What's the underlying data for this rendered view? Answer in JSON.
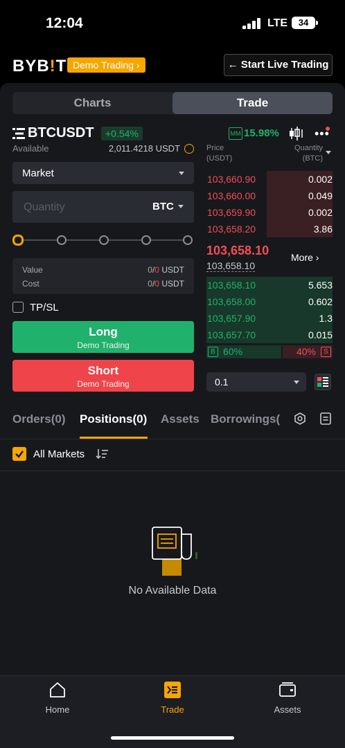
{
  "status_bar": {
    "time": "12:04",
    "network": "LTE",
    "battery": "34"
  },
  "header": {
    "logo_left": "BYB",
    "logo_bar": "!",
    "logo_right": "T",
    "demo_tag": "Demo Trading",
    "live_button": "Start Live Trading"
  },
  "view_tabs": {
    "charts": "Charts",
    "trade": "Trade",
    "selected": "Trade"
  },
  "pair": {
    "symbol": "BTCUSDT",
    "change": "+0.54%",
    "mm_label": "MM",
    "mm_value": "15.98%"
  },
  "order_form": {
    "available_label": "Available",
    "available_value": "2,011.4218 USDT",
    "order_type": "Market",
    "quantity_placeholder": "Quantity",
    "quantity_unit": "BTC",
    "leverage_fraction": 0,
    "value_label": "Value",
    "value_amount": "0/0 USDT",
    "value_a": "0",
    "value_b": "0",
    "value_unit": "USDT",
    "cost_label": "Cost",
    "cost_a": "0",
    "cost_b": "0",
    "cost_unit": "USDT",
    "tpsl_label": "TP/SL",
    "long_label": "Long",
    "long_sub": "Demo Trading",
    "short_label": "Short",
    "short_sub": "Demo Trading"
  },
  "orderbook": {
    "price_header": "Price",
    "price_unit": "(USDT)",
    "qty_header": "Quantity",
    "qty_unit": "(BTC)",
    "asks": [
      {
        "price": "103,660.90",
        "qty": "0.002",
        "depth": 0.52
      },
      {
        "price": "103,660.00",
        "qty": "0.049",
        "depth": 0.52
      },
      {
        "price": "103,659.90",
        "qty": "0.002",
        "depth": 0.52
      },
      {
        "price": "103,658.20",
        "qty": "3.86",
        "depth": 0.52
      }
    ],
    "last_price": "103,658.10",
    "mark_price": "103,658.10",
    "more_label": "More",
    "bids": [
      {
        "price": "103,658.10",
        "qty": "5.653",
        "depth": 1.0
      },
      {
        "price": "103,658.00",
        "qty": "0.602",
        "depth": 1.0
      },
      {
        "price": "103,657.90",
        "qty": "1.3",
        "depth": 1.0
      },
      {
        "price": "103,657.70",
        "qty": "0.015",
        "depth": 1.0
      }
    ],
    "buy_letter": "B",
    "buy_ratio": "60%",
    "sell_ratio": "40%",
    "sell_letter": "S",
    "depth_step": "0.1"
  },
  "bottom_tabs": {
    "orders": "Orders(0)",
    "positions": "Positions(0)",
    "assets": "Assets",
    "borrowings": "Borrowings(",
    "all_markets": "All Markets",
    "empty_text": "No Available Data"
  },
  "nav": {
    "home": "Home",
    "trade": "Trade",
    "assets": "Assets",
    "active": "Trade"
  },
  "colors": {
    "accent": "#f7a600",
    "buy": "#20b26c",
    "sell": "#f24e56",
    "background": "#17181c"
  }
}
